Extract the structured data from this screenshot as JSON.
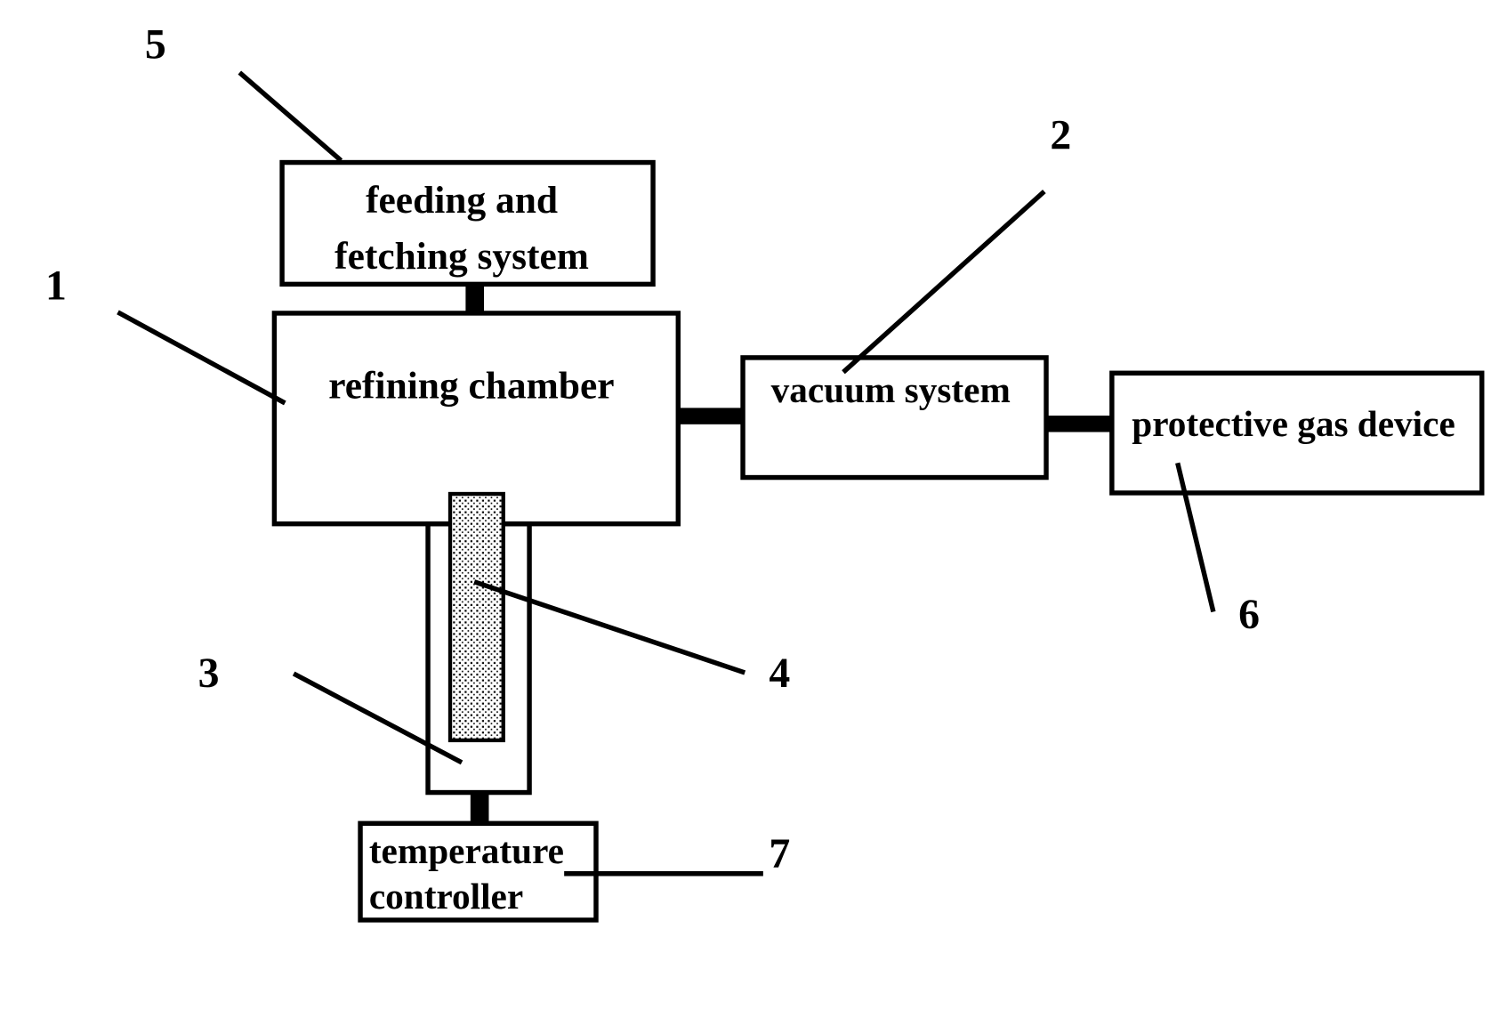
{
  "diagram": {
    "type": "block-diagram",
    "components": [
      {
        "id": "1",
        "label": "refining chamber"
      },
      {
        "id": "2",
        "label": "vacuum system"
      },
      {
        "id": "3",
        "label": "",
        "description": "heating tube / furnace body below chamber"
      },
      {
        "id": "4",
        "label": "",
        "description": "stippled sample rod"
      },
      {
        "id": "5",
        "label_line1": "feeding and",
        "label_line2": "fetching system"
      },
      {
        "id": "6",
        "label": "protective gas device"
      },
      {
        "id": "7",
        "label_line1": "temperature",
        "label_line2": "controller"
      }
    ],
    "reference_numerals": [
      "1",
      "2",
      "3",
      "4",
      "5",
      "6",
      "7"
    ],
    "connections": [
      [
        "5",
        "1"
      ],
      [
        "1",
        "2"
      ],
      [
        "2",
        "6"
      ],
      [
        "3",
        "7"
      ]
    ],
    "colors": {
      "stroke": "#000000",
      "background": "#ffffff"
    }
  }
}
